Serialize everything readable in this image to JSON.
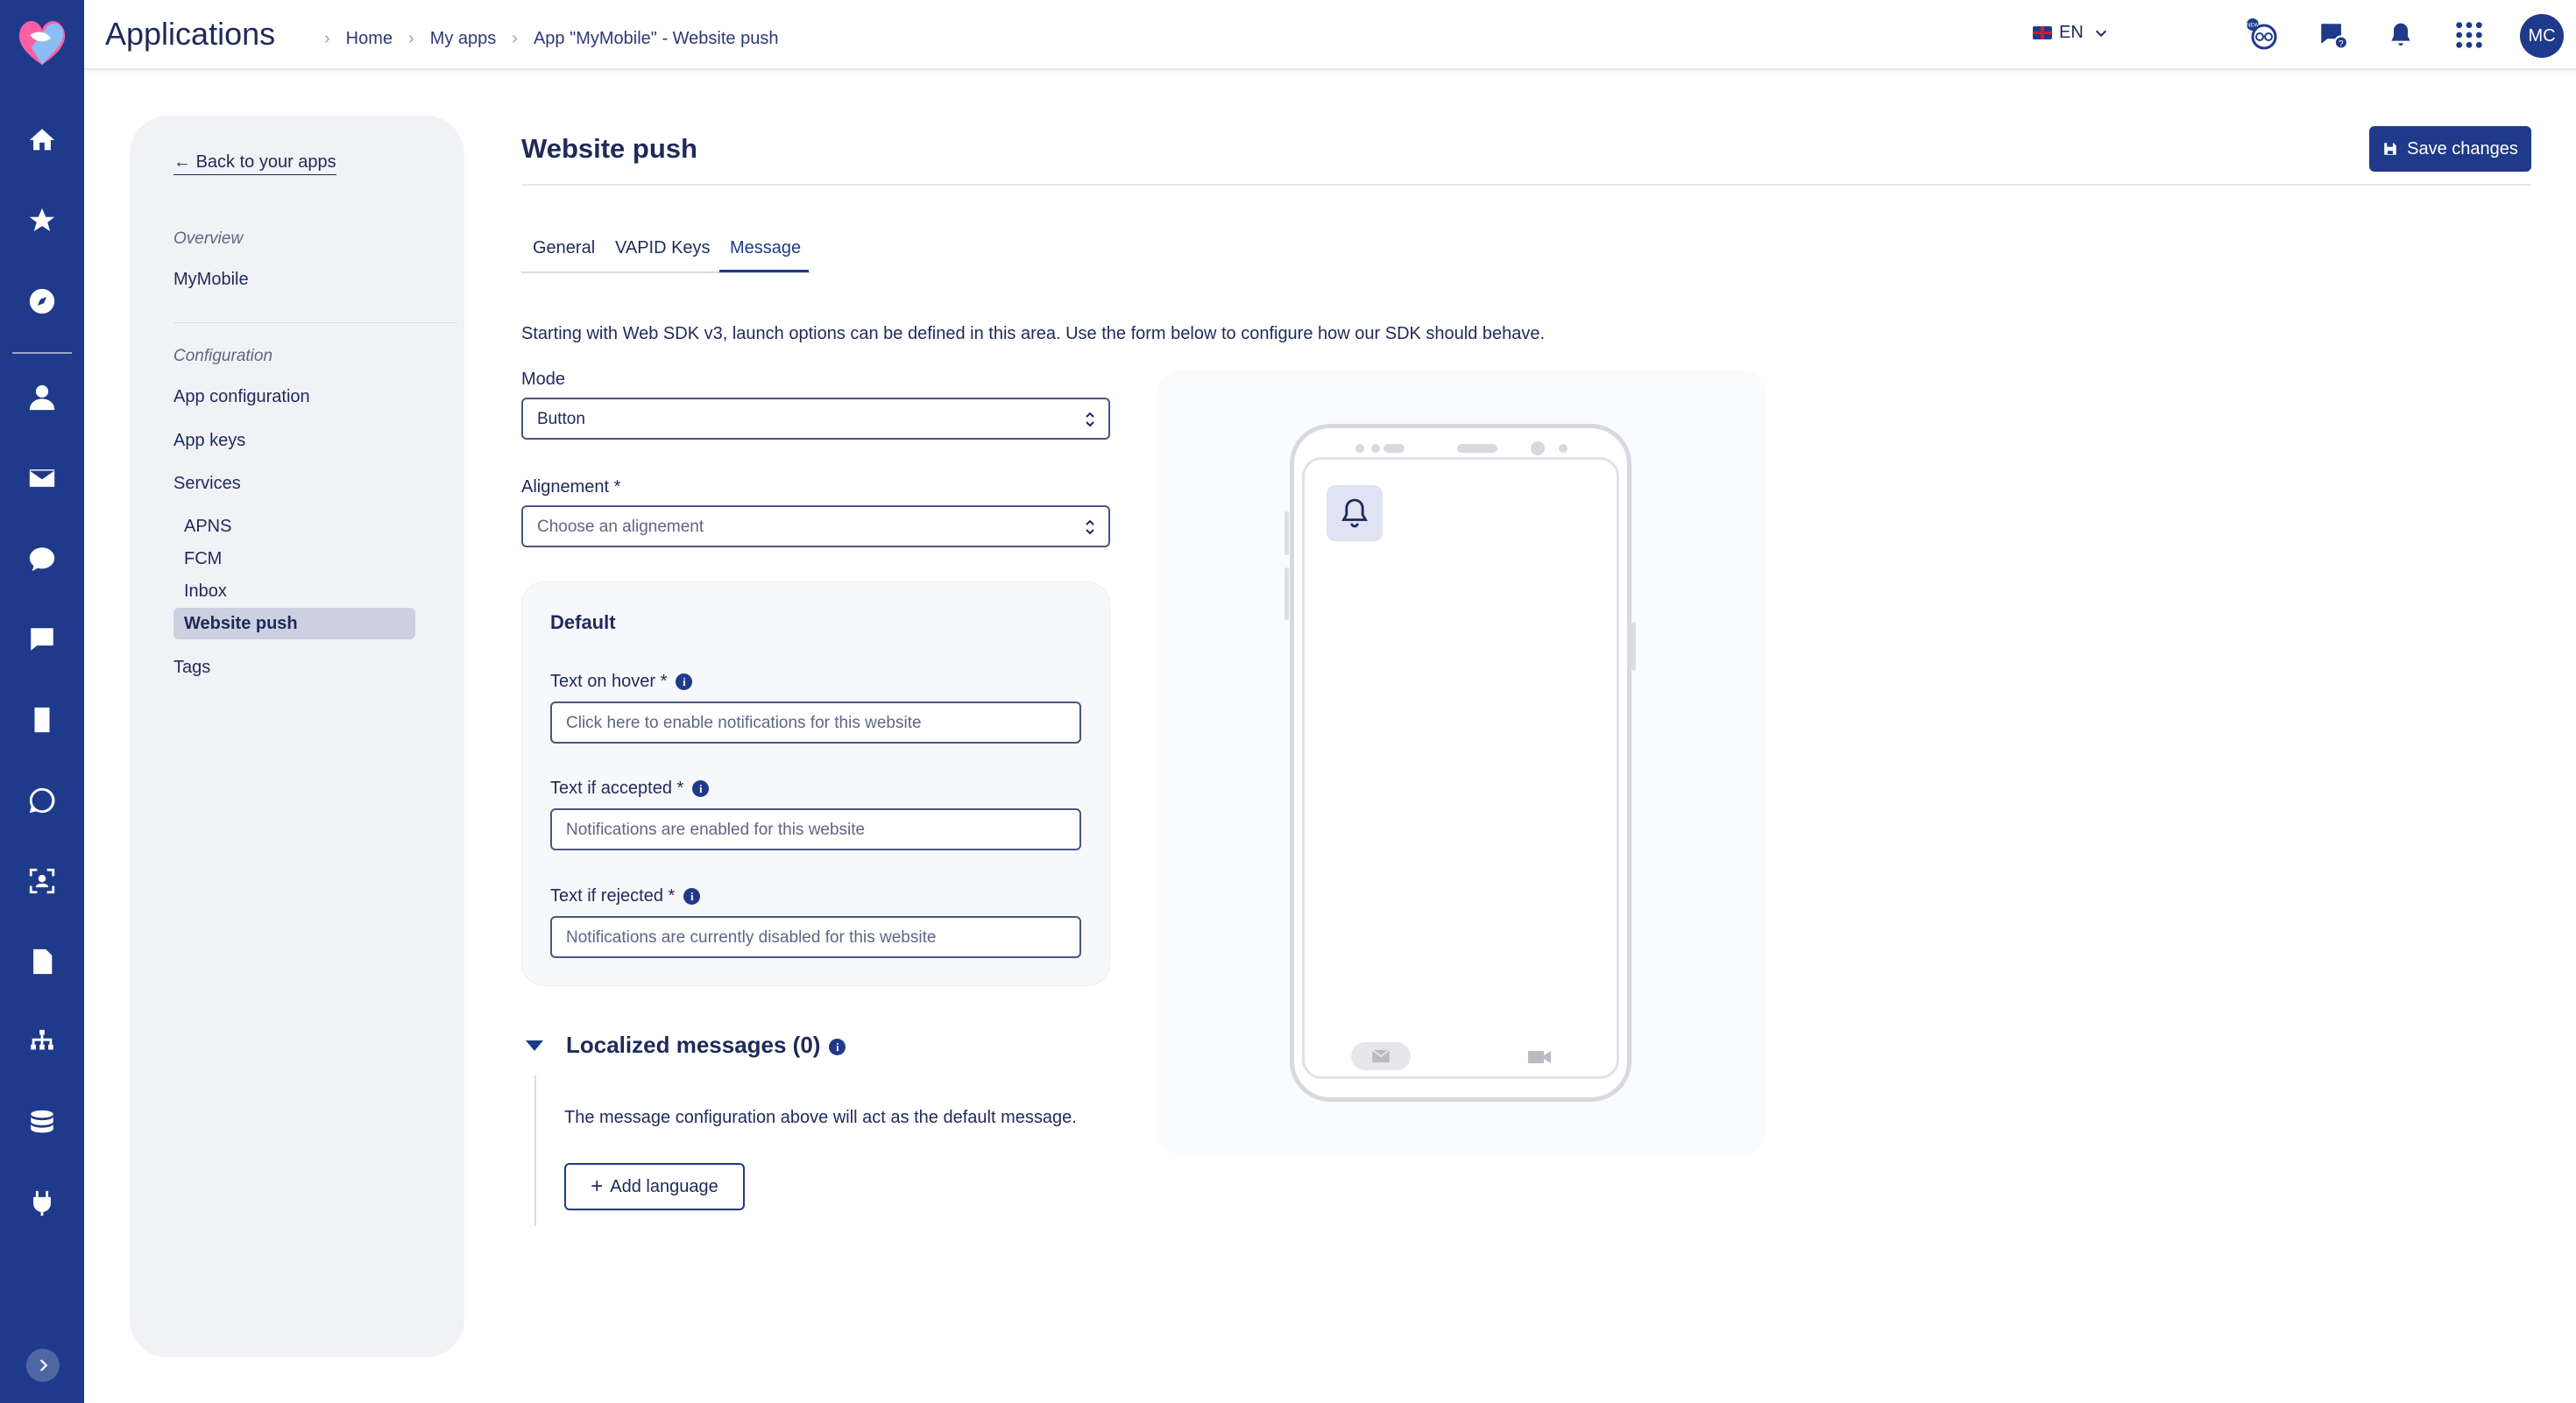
{
  "header": {
    "app_title": "Applications",
    "breadcrumbs": [
      "Home",
      "My apps",
      "App \"MyMobile\" - Website push"
    ],
    "language": "EN",
    "avatar_initials": "MC",
    "notification_badge": "NEW"
  },
  "sidebar": {
    "back_label": "Back to your apps",
    "overview_label": "Overview",
    "app_name": "MyMobile",
    "configuration_label": "Configuration",
    "app_configuration": "App configuration",
    "app_keys": "App keys",
    "services": "Services",
    "sub_items": [
      "APNS",
      "FCM",
      "Inbox",
      "Website push"
    ],
    "tags": "Tags"
  },
  "main": {
    "title": "Website push",
    "save_label": "Save changes",
    "tabs": [
      "General",
      "VAPID Keys",
      "Message"
    ],
    "active_tab": "Message",
    "intro": "Starting with Web SDK v3, launch options can be defined in this area. Use the form below to configure how our SDK should behave.",
    "mode_label": "Mode",
    "mode_value": "Button",
    "alignment_label": "Alignement *",
    "alignment_placeholder": "Choose an alignement",
    "default_card": {
      "title": "Default",
      "hover_label": "Text on hover *",
      "hover_placeholder": "Click here to enable notifications for this website",
      "accepted_label": "Text if accepted *",
      "accepted_placeholder": "Notifications are enabled for this website",
      "rejected_label": "Text if rejected *",
      "rejected_placeholder": "Notifications are currently disabled for this website"
    },
    "localized": {
      "title": "Localized messages (0)",
      "description": "The message configuration above will act as the default message.",
      "add_label": "Add language"
    }
  },
  "colors": {
    "brand_navy": "#1f3a8a",
    "text": "#1e2a5a",
    "panel_bg": "#f1f2f6",
    "active_item": "#ccd0e0"
  }
}
